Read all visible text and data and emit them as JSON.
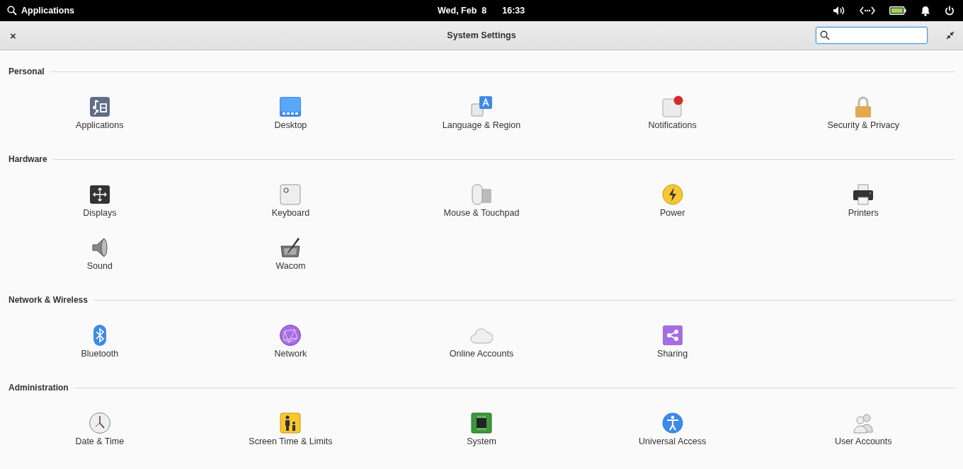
{
  "top_panel": {
    "applications": "Applications",
    "date": "Wed, Feb  8",
    "time": "16:33"
  },
  "window": {
    "title": "System Settings",
    "close": "×"
  },
  "sections": [
    {
      "title": "Personal",
      "items": [
        {
          "label": "Applications"
        },
        {
          "label": "Desktop"
        },
        {
          "label": "Language & Region"
        },
        {
          "label": "Notifications"
        },
        {
          "label": "Security & Privacy"
        }
      ]
    },
    {
      "title": "Hardware",
      "items": [
        {
          "label": "Displays"
        },
        {
          "label": "Keyboard"
        },
        {
          "label": "Mouse & Touchpad"
        },
        {
          "label": "Power"
        },
        {
          "label": "Printers"
        },
        {
          "label": "Sound"
        },
        {
          "label": "Wacom"
        }
      ]
    },
    {
      "title": "Network & Wireless",
      "items": [
        {
          "label": "Bluetooth"
        },
        {
          "label": "Network"
        },
        {
          "label": "Online Accounts"
        },
        {
          "label": "Sharing"
        }
      ]
    },
    {
      "title": "Administration",
      "items": [
        {
          "label": "Date & Time"
        },
        {
          "label": "Screen Time & Limits"
        },
        {
          "label": "System"
        },
        {
          "label": "Universal Access"
        },
        {
          "label": "User Accounts"
        }
      ]
    }
  ]
}
